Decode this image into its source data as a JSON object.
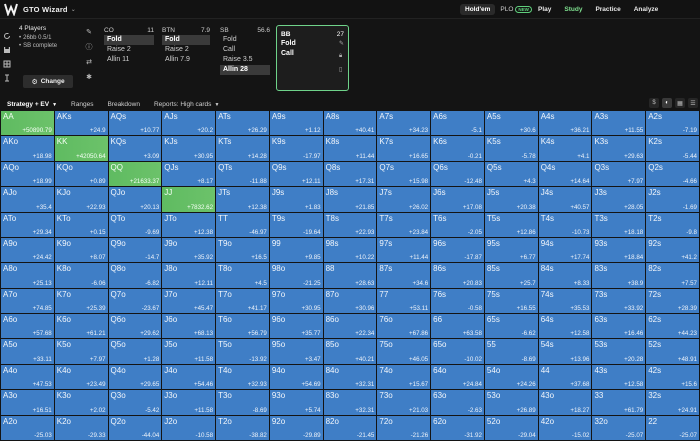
{
  "header": {
    "brand": "GTO Wizard",
    "game_tabs": [
      {
        "label": "Hold'em",
        "active": true
      },
      {
        "label": "PLO",
        "active": false,
        "badge": "NEW"
      }
    ],
    "nav": [
      {
        "label": "Play",
        "active": false
      },
      {
        "label": "Study",
        "active": true
      },
      {
        "label": "Practice",
        "active": false
      },
      {
        "label": "Analyze",
        "active": false
      }
    ]
  },
  "settings": {
    "players": "4 Players",
    "stack": "26bb 0.5/1",
    "mode": "SB complete",
    "change_label": "Change"
  },
  "positions": [
    {
      "name": "CO",
      "stack": "11",
      "actions": [
        "Fold",
        "Raise 2",
        "Allin 11"
      ],
      "selected": 0
    },
    {
      "name": "BTN",
      "stack": "7.9",
      "actions": [
        "Fold",
        "Raise 2",
        "Allin 7.9"
      ],
      "selected": 0
    },
    {
      "name": "SB",
      "stack": "56.6",
      "actions": [
        "Fold",
        "Call",
        "Raise 3.5",
        "Allin 28"
      ],
      "selected": 3
    },
    {
      "name": "BB",
      "stack": "27",
      "actions": [
        "Fold",
        "Call"
      ],
      "selected": -1
    }
  ],
  "tabs": {
    "strategy": "Strategy + EV",
    "ranges": "Ranges",
    "breakdown": "Breakdown",
    "reports": "Reports: High cards"
  },
  "colors": {
    "accent": "#7ee08f",
    "cell_blue": "#3f7ec6",
    "cell_green": "#64bf65"
  },
  "matrix": [
    [
      "AA",
      "+50890.79",
      "1"
    ],
    [
      "AKs",
      "+24.9",
      "0"
    ],
    [
      "AQs",
      "+10.77",
      "0"
    ],
    [
      "AJs",
      "+20.2",
      "0"
    ],
    [
      "ATs",
      "+26.29",
      "0"
    ],
    [
      "A9s",
      "+1.12",
      "0"
    ],
    [
      "A8s",
      "+40.41",
      "0"
    ],
    [
      "A7s",
      "+34.23",
      "0"
    ],
    [
      "A6s",
      "-5.1",
      "0"
    ],
    [
      "A5s",
      "+30.6",
      "0"
    ],
    [
      "A4s",
      "+36.21",
      "0"
    ],
    [
      "A3s",
      "+11.55",
      "0"
    ],
    [
      "A2s",
      "-7.19",
      "0"
    ],
    [
      "AKo",
      "+18.98",
      "0"
    ],
    [
      "KK",
      "+42050.64",
      "1"
    ],
    [
      "KQs",
      "+3.09",
      "0"
    ],
    [
      "KJs",
      "+30.95",
      "0"
    ],
    [
      "KTs",
      "+14.28",
      "0"
    ],
    [
      "K9s",
      "-17.97",
      "0"
    ],
    [
      "K8s",
      "+11.44",
      "0"
    ],
    [
      "K7s",
      "+16.65",
      "0"
    ],
    [
      "K6s",
      "-0.21",
      "0"
    ],
    [
      "K5s",
      "-5.78",
      "0"
    ],
    [
      "K4s",
      "+4.1",
      "0"
    ],
    [
      "K3s",
      "+29.63",
      "0"
    ],
    [
      "K2s",
      "-5.44",
      "0"
    ],
    [
      "AQo",
      "+18.99",
      "0"
    ],
    [
      "KQo",
      "+0.89",
      "0"
    ],
    [
      "QQ",
      "+21633.37",
      "1"
    ],
    [
      "QJs",
      "+8.17",
      "0"
    ],
    [
      "QTs",
      "-11.88",
      "0"
    ],
    [
      "Q9s",
      "+12.11",
      "0"
    ],
    [
      "Q8s",
      "+17.31",
      "0"
    ],
    [
      "Q7s",
      "+15.98",
      "0"
    ],
    [
      "Q6s",
      "-12.48",
      "0"
    ],
    [
      "Q5s",
      "+4.3",
      "0"
    ],
    [
      "Q4s",
      "+14.64",
      "0"
    ],
    [
      "Q3s",
      "+7.97",
      "0"
    ],
    [
      "Q2s",
      "-4.66",
      "0"
    ],
    [
      "AJo",
      "+35.4",
      "0"
    ],
    [
      "KJo",
      "+22.93",
      "0"
    ],
    [
      "QJo",
      "+20.13",
      "0"
    ],
    [
      "JJ",
      "+7832.62",
      "1"
    ],
    [
      "JTs",
      "+12.38",
      "0"
    ],
    [
      "J9s",
      "+1.83",
      "0"
    ],
    [
      "J8s",
      "+21.85",
      "0"
    ],
    [
      "J7s",
      "+26.02",
      "0"
    ],
    [
      "J6s",
      "+17.08",
      "0"
    ],
    [
      "J5s",
      "+20.38",
      "0"
    ],
    [
      "J4s",
      "+40.57",
      "0"
    ],
    [
      "J3s",
      "+28.05",
      "0"
    ],
    [
      "J2s",
      "-1.69",
      "0"
    ],
    [
      "ATo",
      "+29.34",
      "0"
    ],
    [
      "KTo",
      "+0.15",
      "0"
    ],
    [
      "QTo",
      "-9.69",
      "0"
    ],
    [
      "JTo",
      "+12.38",
      "0"
    ],
    [
      "TT",
      "-46.97",
      "0"
    ],
    [
      "T9s",
      "-19.64",
      "0"
    ],
    [
      "T8s",
      "+22.93",
      "0"
    ],
    [
      "T7s",
      "+23.84",
      "0"
    ],
    [
      "T6s",
      "-2.05",
      "0"
    ],
    [
      "T5s",
      "+12.86",
      "0"
    ],
    [
      "T4s",
      "-10.73",
      "0"
    ],
    [
      "T3s",
      "+18.18",
      "0"
    ],
    [
      "T2s",
      "-9.8",
      "0"
    ],
    [
      "A9o",
      "+24.42",
      "0"
    ],
    [
      "K9o",
      "+8.07",
      "0"
    ],
    [
      "Q9o",
      "-14.7",
      "0"
    ],
    [
      "J9o",
      "+35.92",
      "0"
    ],
    [
      "T9o",
      "+16.5",
      "0"
    ],
    [
      "99",
      "+9.85",
      "0"
    ],
    [
      "98s",
      "+10.22",
      "0"
    ],
    [
      "97s",
      "+11.44",
      "0"
    ],
    [
      "96s",
      "-17.87",
      "0"
    ],
    [
      "95s",
      "+6.77",
      "0"
    ],
    [
      "94s",
      "+17.74",
      "0"
    ],
    [
      "93s",
      "+18.84",
      "0"
    ],
    [
      "92s",
      "+41.2",
      "0"
    ],
    [
      "A8o",
      "+25.13",
      "0"
    ],
    [
      "K8o",
      "-6.06",
      "0"
    ],
    [
      "Q8o",
      "-6.82",
      "0"
    ],
    [
      "J8o",
      "+12.11",
      "0"
    ],
    [
      "T8o",
      "+4.5",
      "0"
    ],
    [
      "98o",
      "-21.25",
      "0"
    ],
    [
      "88",
      "+28.63",
      "0"
    ],
    [
      "87s",
      "+34.6",
      "0"
    ],
    [
      "86s",
      "+20.83",
      "0"
    ],
    [
      "85s",
      "+25.7",
      "0"
    ],
    [
      "84s",
      "+8.33",
      "0"
    ],
    [
      "83s",
      "+38.9",
      "0"
    ],
    [
      "82s",
      "+7.57",
      "0"
    ],
    [
      "A7o",
      "+74.85",
      "0"
    ],
    [
      "K7o",
      "+25.39",
      "0"
    ],
    [
      "Q7o",
      "-23.67",
      "0"
    ],
    [
      "J7o",
      "+45.47",
      "0"
    ],
    [
      "T7o",
      "+41.17",
      "0"
    ],
    [
      "97o",
      "+30.95",
      "0"
    ],
    [
      "87o",
      "+30.96",
      "0"
    ],
    [
      "77",
      "+53.11",
      "0"
    ],
    [
      "76s",
      "-0.58",
      "0"
    ],
    [
      "75s",
      "+16.55",
      "0"
    ],
    [
      "74s",
      "+35.53",
      "0"
    ],
    [
      "73s",
      "+33.92",
      "0"
    ],
    [
      "72s",
      "+28.39",
      "0"
    ],
    [
      "A6o",
      "+57.68",
      "0"
    ],
    [
      "K6o",
      "+61.21",
      "0"
    ],
    [
      "Q6o",
      "+29.62",
      "0"
    ],
    [
      "J6o",
      "+68.13",
      "0"
    ],
    [
      "T6o",
      "+56.79",
      "0"
    ],
    [
      "96o",
      "+35.77",
      "0"
    ],
    [
      "86o",
      "+22.34",
      "0"
    ],
    [
      "76o",
      "+67.86",
      "0"
    ],
    [
      "66",
      "+63.58",
      "0"
    ],
    [
      "65s",
      "-6.62",
      "0"
    ],
    [
      "64s",
      "+12.58",
      "0"
    ],
    [
      "63s",
      "+16.46",
      "0"
    ],
    [
      "62s",
      "+44.23",
      "0"
    ],
    [
      "A5o",
      "+33.11",
      "0"
    ],
    [
      "K5o",
      "+7.97",
      "0"
    ],
    [
      "Q5o",
      "+1.28",
      "0"
    ],
    [
      "J5o",
      "+11.58",
      "0"
    ],
    [
      "T5o",
      "-13.92",
      "0"
    ],
    [
      "95o",
      "+3.47",
      "0"
    ],
    [
      "85o",
      "+40.21",
      "0"
    ],
    [
      "75o",
      "+46.05",
      "0"
    ],
    [
      "65o",
      "-10.02",
      "0"
    ],
    [
      "55",
      "-8.69",
      "0"
    ],
    [
      "54s",
      "+13.96",
      "0"
    ],
    [
      "53s",
      "+20.28",
      "0"
    ],
    [
      "52s",
      "+48.91",
      "0"
    ],
    [
      "A4o",
      "+47.53",
      "0"
    ],
    [
      "K4o",
      "+23.49",
      "0"
    ],
    [
      "Q4o",
      "+29.65",
      "0"
    ],
    [
      "J4o",
      "+54.46",
      "0"
    ],
    [
      "T4o",
      "+32.93",
      "0"
    ],
    [
      "94o",
      "+54.69",
      "0"
    ],
    [
      "84o",
      "+32.31",
      "0"
    ],
    [
      "74o",
      "+15.67",
      "0"
    ],
    [
      "64o",
      "+24.84",
      "0"
    ],
    [
      "54o",
      "+24.26",
      "0"
    ],
    [
      "44",
      "+37.68",
      "0"
    ],
    [
      "43s",
      "+12.58",
      "0"
    ],
    [
      "42s",
      "+15.6",
      "0"
    ],
    [
      "A3o",
      "+16.51",
      "0"
    ],
    [
      "K3o",
      "+2.02",
      "0"
    ],
    [
      "Q3o",
      "-5.42",
      "0"
    ],
    [
      "J3o",
      "+11.58",
      "0"
    ],
    [
      "T3o",
      "-8.69",
      "0"
    ],
    [
      "93o",
      "+5.74",
      "0"
    ],
    [
      "83o",
      "+32.31",
      "0"
    ],
    [
      "73o",
      "+21.03",
      "0"
    ],
    [
      "63o",
      "-2.63",
      "0"
    ],
    [
      "53o",
      "+26.89",
      "0"
    ],
    [
      "43o",
      "+18.27",
      "0"
    ],
    [
      "33",
      "+61.79",
      "0"
    ],
    [
      "32s",
      "+24.91",
      "0"
    ],
    [
      "A2o",
      "-25.03",
      "0"
    ],
    [
      "K2o",
      "-29.33",
      "0"
    ],
    [
      "Q2o",
      "-44.04",
      "0"
    ],
    [
      "J2o",
      "-10.58",
      "0"
    ],
    [
      "T2o",
      "-38.82",
      "0"
    ],
    [
      "92o",
      "-29.89",
      "0"
    ],
    [
      "82o",
      "-21.45",
      "0"
    ],
    [
      "72o",
      "-21.26",
      "0"
    ],
    [
      "62o",
      "-31.92",
      "0"
    ],
    [
      "52o",
      "-29.04",
      "0"
    ],
    [
      "42o",
      "-15.02",
      "0"
    ],
    [
      "32o",
      "-25.07",
      "0"
    ],
    [
      "22",
      "-25.07",
      "0"
    ]
  ]
}
